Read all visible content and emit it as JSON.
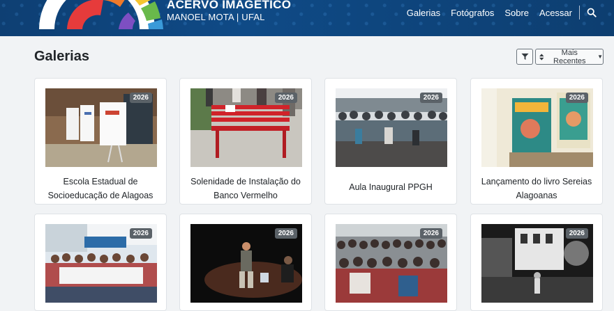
{
  "brand": {
    "title": "ACERVO IMAGÉTICO",
    "subtitle": "MANOEL MOTA | UFAL",
    "logo_colors": [
      "#e63b3b",
      "#f07a2a",
      "#f4c531",
      "#69b94b",
      "#3a9ad9",
      "#7d4fc2"
    ]
  },
  "nav": {
    "items": [
      "Galerias",
      "Fotógrafos",
      "Sobre",
      "Acessar"
    ],
    "search_icon": "search-icon"
  },
  "main": {
    "title": "Galerias",
    "filter_icon": "filter-icon",
    "sort_label": "Mais Recentes"
  },
  "galleries": [
    {
      "year": "2026",
      "title": "Escola Estadual de Socioeducação de Alagoas"
    },
    {
      "year": "2026",
      "title": "Solenidade de Instalação do Banco Vermelho"
    },
    {
      "year": "2026",
      "title": "Aula Inaugural PPGH"
    },
    {
      "year": "2026",
      "title": "Lançamento do livro Sereias Alagoanas"
    },
    {
      "year": "2026",
      "title": ""
    },
    {
      "year": "2026",
      "title": ""
    },
    {
      "year": "2026",
      "title": ""
    },
    {
      "year": "2026",
      "title": ""
    }
  ]
}
